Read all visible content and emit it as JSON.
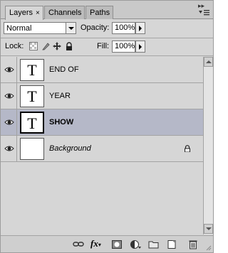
{
  "tabs": [
    {
      "label": "Layers",
      "close": "×",
      "active": true
    },
    {
      "label": "Channels",
      "active": false
    },
    {
      "label": "Paths",
      "active": false
    }
  ],
  "panel_menu_icon": "panel-menu-icon",
  "collapse_icon": "double-arrow-icon",
  "blend_mode": {
    "value": "Normal"
  },
  "opacity": {
    "label": "Opacity:",
    "value": "100%"
  },
  "lock": {
    "label": "Lock:"
  },
  "fill": {
    "label": "Fill:",
    "value": "100%"
  },
  "layers": [
    {
      "name": "END OF",
      "type": "text",
      "thumb": "T",
      "visible": true,
      "selected": false
    },
    {
      "name": "YEAR",
      "type": "text",
      "thumb": "T",
      "visible": true,
      "selected": false
    },
    {
      "name": "SHOW",
      "type": "text",
      "thumb": "T",
      "visible": true,
      "selected": true
    },
    {
      "name": "Background",
      "type": "background",
      "thumb": "",
      "visible": true,
      "selected": false,
      "locked": true
    }
  ],
  "bottom_icons": [
    "link-layers-icon",
    "layer-style-fx-icon",
    "layer-mask-icon",
    "adjustment-layer-icon",
    "new-group-icon",
    "new-layer-icon",
    "delete-layer-icon"
  ],
  "bottom_fx": "fx",
  "colors": {
    "selected_row": "#b5b8c8",
    "panel_bg": "#d6d6d6"
  }
}
